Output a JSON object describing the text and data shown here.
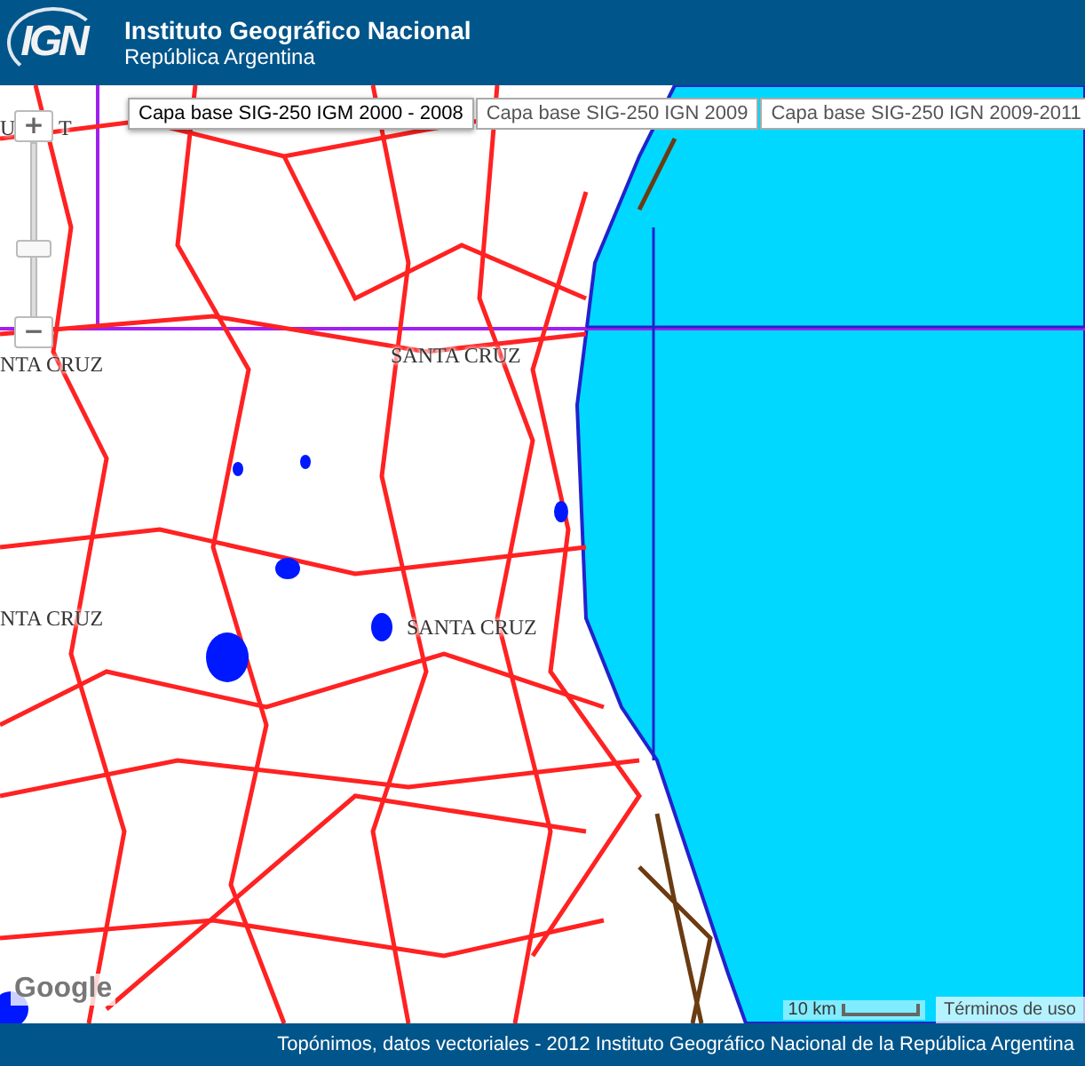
{
  "header": {
    "logo": "IGN",
    "title": "Instituto Geográfico Nacional",
    "subtitle": "República Argentina"
  },
  "layers": [
    {
      "label": "Capa base SIG-250 IGM 2000 - 2008",
      "selected": true
    },
    {
      "label": "Capa base SIG-250 IGN 2009",
      "selected": false
    },
    {
      "label": "Capa base SIG-250 IGN 2009-2011",
      "selected": false
    }
  ],
  "zoom": {
    "plus": "+",
    "minus": "−",
    "level": 0.38
  },
  "map_labels": [
    {
      "text": "U"
    },
    {
      "text": "T"
    },
    {
      "text": "NTA CRUZ"
    },
    {
      "text": "SANTA CRUZ"
    },
    {
      "text": "NTA CRUZ"
    },
    {
      "text": "SANTA CRUZ"
    }
  ],
  "map_attribution": "Google",
  "scale": {
    "label": "10 km"
  },
  "terms": "Términos de uso",
  "footer": "Topónimos, datos vectoriales - 2012 Instituto Geográfico Nacional de la República Argentina"
}
